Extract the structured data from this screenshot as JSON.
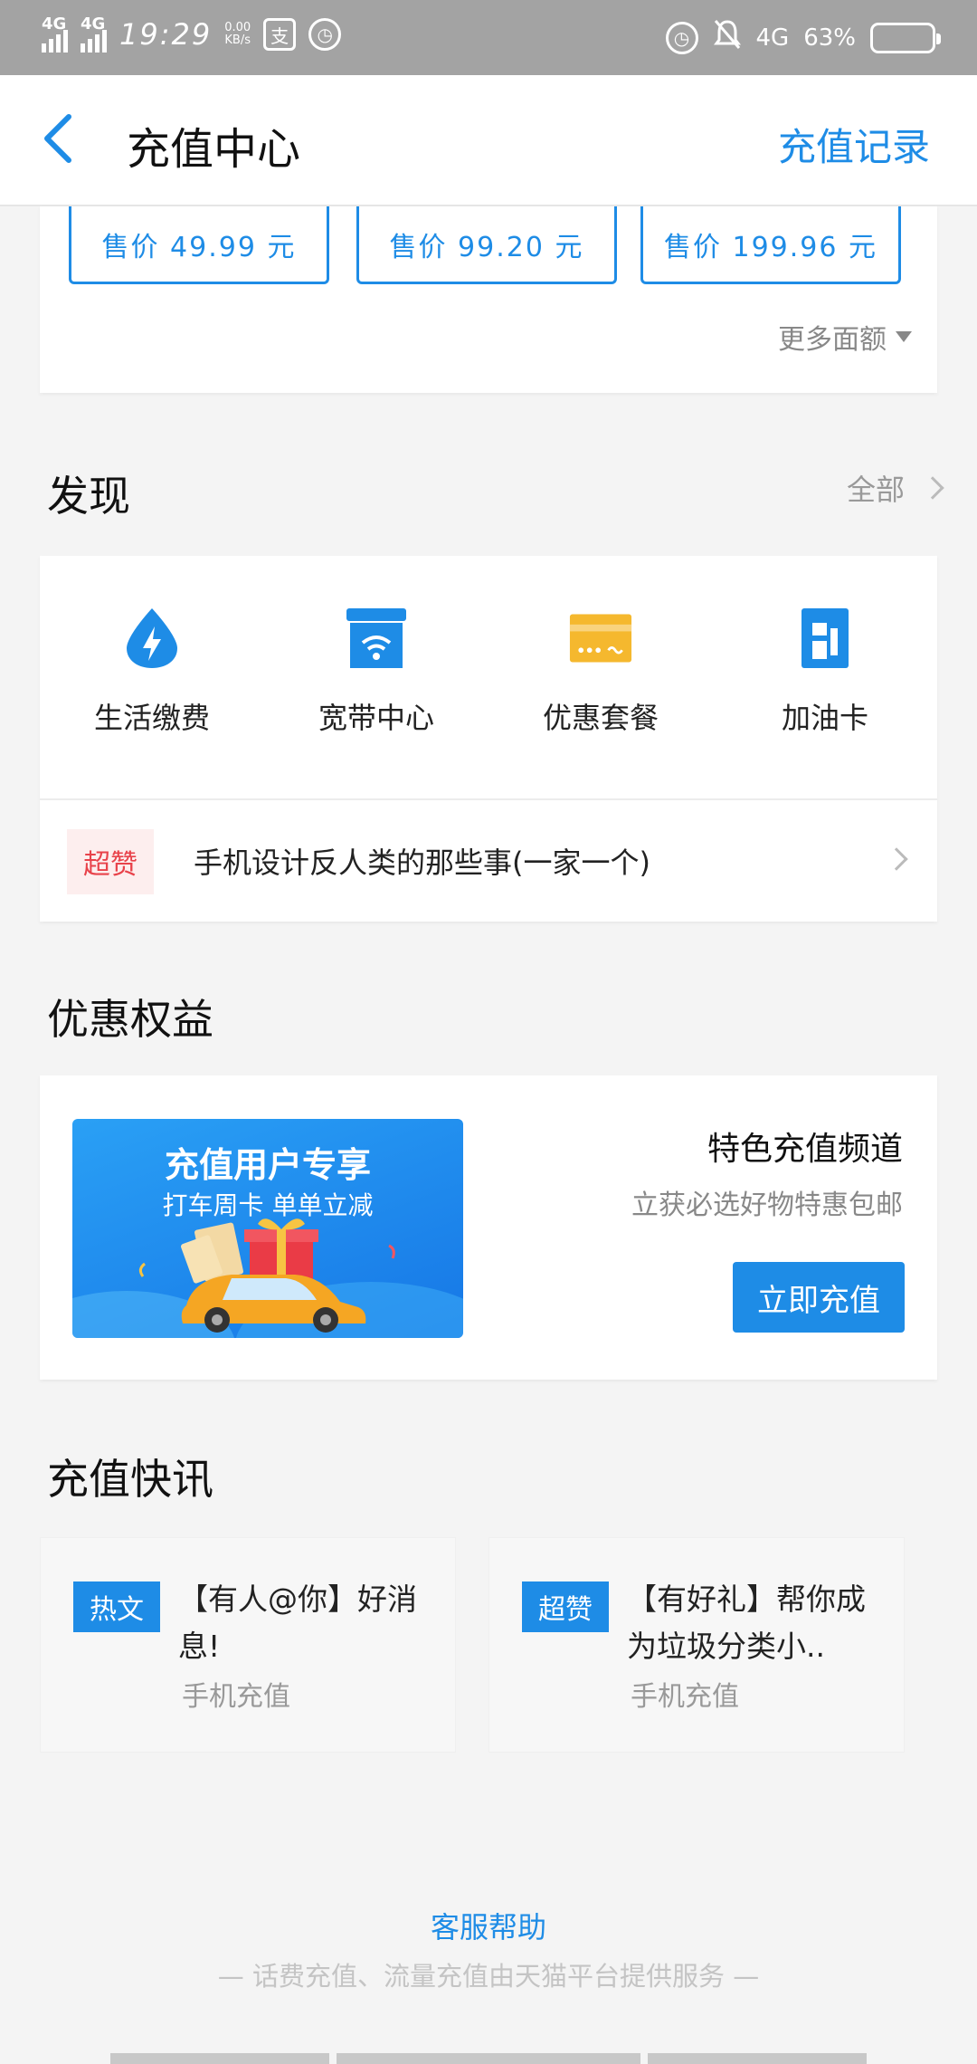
{
  "status_bar": {
    "network1": "4G",
    "network2": "4G",
    "time": "19:29",
    "speed_value": "0.00",
    "speed_unit": "KB/s",
    "network3": "4G",
    "battery_percent": "63%",
    "battery_level": 0.63
  },
  "header": {
    "title": "充值中心",
    "record_link": "充值记录"
  },
  "prices": {
    "items": [
      "售价 49.99 元",
      "售价 99.20 元",
      "售价 199.96 元"
    ],
    "more_label": "更多面额"
  },
  "discover": {
    "title": "发现",
    "all_label": "全部",
    "items": [
      {
        "label": "生活缴费",
        "icon": "water-drop-bolt-icon"
      },
      {
        "label": "宽带中心",
        "icon": "wifi-store-icon"
      },
      {
        "label": "优惠套餐",
        "icon": "card-icon"
      },
      {
        "label": "加油卡",
        "icon": "fuel-pump-icon"
      }
    ],
    "news": {
      "badge": "超赞",
      "text": "手机设计反人类的那些事(一家一个)"
    }
  },
  "benefits": {
    "title": "优惠权益",
    "banner_title": "充值用户专享",
    "banner_subtitle": "打车周卡 单单立减",
    "feature_title": "特色充值频道",
    "feature_subtitle": "立获必选好物特惠包邮",
    "button_label": "立即充值"
  },
  "quick_news": {
    "title": "充值快讯",
    "items": [
      {
        "badge": "热文",
        "title": "【有人@你】好消息!",
        "source": "手机充值"
      },
      {
        "badge": "超赞",
        "title": "【有好礼】帮你成为垃圾分类小..",
        "source": "手机充值"
      }
    ]
  },
  "footer": {
    "help": "客服帮助",
    "note": "— 话费充值、流量充值由天猫平台提供服务 —"
  },
  "colors": {
    "accent": "#1e8ce6",
    "hot_red": "#e8424a",
    "card_yellow": "#f5b82e"
  }
}
